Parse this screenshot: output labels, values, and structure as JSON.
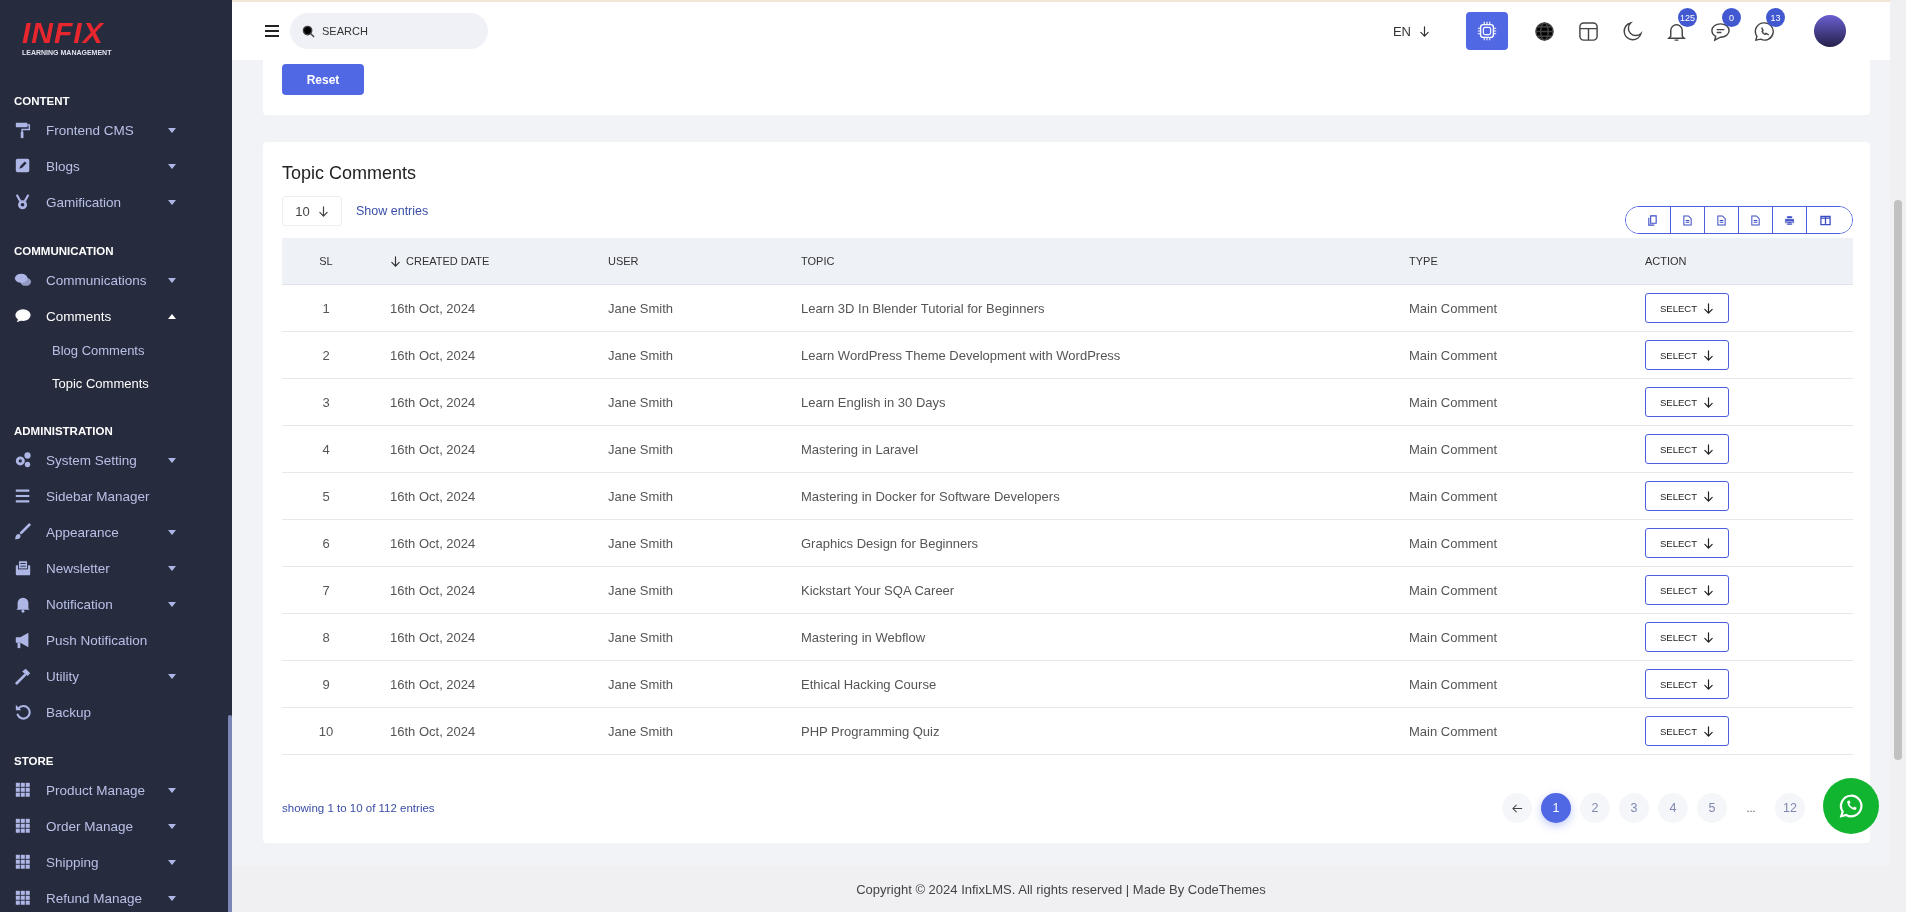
{
  "sidebar": {
    "logo": {
      "brand": "INFIX",
      "tagline": "LEARNING MANAGEMENT"
    },
    "sections": [
      {
        "title": "CONTENT",
        "items": [
          {
            "label": "Frontend CMS",
            "kind": "menu",
            "expanded": false
          },
          {
            "label": "Blogs",
            "kind": "menu",
            "expanded": false
          },
          {
            "label": "Gamification",
            "kind": "menu",
            "expanded": false
          }
        ]
      },
      {
        "title": "COMMUNICATION",
        "items": [
          {
            "label": "Communications",
            "kind": "menu",
            "expanded": false
          },
          {
            "label": "Comments",
            "kind": "menu",
            "expanded": true,
            "children": [
              {
                "label": "Blog Comments",
                "selected": false
              },
              {
                "label": "Topic Comments",
                "selected": true
              }
            ]
          }
        ]
      },
      {
        "title": "ADMINISTRATION",
        "items": [
          {
            "label": "System Setting",
            "kind": "menu",
            "expanded": false
          },
          {
            "label": "Sidebar Manager",
            "kind": "link"
          },
          {
            "label": "Appearance",
            "kind": "menu",
            "expanded": false
          },
          {
            "label": "Newsletter",
            "kind": "menu",
            "expanded": false
          },
          {
            "label": "Notification",
            "kind": "menu",
            "expanded": false
          },
          {
            "label": "Push Notification",
            "kind": "link"
          },
          {
            "label": "Utility",
            "kind": "menu",
            "expanded": false
          },
          {
            "label": "Backup",
            "kind": "link"
          }
        ]
      },
      {
        "title": "STORE",
        "items": [
          {
            "label": "Product Manage",
            "kind": "menu",
            "expanded": false
          },
          {
            "label": "Order Manage",
            "kind": "menu",
            "expanded": false
          },
          {
            "label": "Shipping",
            "kind": "menu",
            "expanded": false
          },
          {
            "label": "Refund Manage",
            "kind": "menu",
            "expanded": false
          }
        ]
      }
    ]
  },
  "header": {
    "search": {
      "placeholder": "SEARCH"
    },
    "language": "EN",
    "badges": {
      "notifications": "125",
      "messages": "0",
      "chats": "13"
    }
  },
  "filter_card": {
    "reset_button": "Reset"
  },
  "table_card": {
    "title": "Topic Comments",
    "page_size": "10",
    "show_entries": "Show entries",
    "columns": [
      "SL",
      "CREATED DATE",
      "USER",
      "TOPIC",
      "TYPE",
      "ACTION"
    ],
    "rows": [
      {
        "sl": "1",
        "created_date": "16th Oct, 2024",
        "user": "Jane Smith",
        "topic": "Learn 3D In Blender Tutorial for Beginners",
        "type": "Main Comment",
        "action": "SELECT"
      },
      {
        "sl": "2",
        "created_date": "16th Oct, 2024",
        "user": "Jane Smith",
        "topic": "Learn WordPress Theme Development with WordPress",
        "type": "Main Comment",
        "action": "SELECT"
      },
      {
        "sl": "3",
        "created_date": "16th Oct, 2024",
        "user": "Jane Smith",
        "topic": "Learn English in 30 Days",
        "type": "Main Comment",
        "action": "SELECT"
      },
      {
        "sl": "4",
        "created_date": "16th Oct, 2024",
        "user": "Jane Smith",
        "topic": "Mastering in Laravel",
        "type": "Main Comment",
        "action": "SELECT"
      },
      {
        "sl": "5",
        "created_date": "16th Oct, 2024",
        "user": "Jane Smith",
        "topic": "Mastering in Docker for Software Developers",
        "type": "Main Comment",
        "action": "SELECT"
      },
      {
        "sl": "6",
        "created_date": "16th Oct, 2024",
        "user": "Jane Smith",
        "topic": "Graphics Design for Beginners",
        "type": "Main Comment",
        "action": "SELECT"
      },
      {
        "sl": "7",
        "created_date": "16th Oct, 2024",
        "user": "Jane Smith",
        "topic": "Kickstart Your SQA Career",
        "type": "Main Comment",
        "action": "SELECT"
      },
      {
        "sl": "8",
        "created_date": "16th Oct, 2024",
        "user": "Jane Smith",
        "topic": "Mastering in Webflow",
        "type": "Main Comment",
        "action": "SELECT"
      },
      {
        "sl": "9",
        "created_date": "16th Oct, 2024",
        "user": "Jane Smith",
        "topic": "Ethical Hacking Course",
        "type": "Main Comment",
        "action": "SELECT"
      },
      {
        "sl": "10",
        "created_date": "16th Oct, 2024",
        "user": "Jane Smith",
        "topic": "PHP Programming Quiz",
        "type": "Main Comment",
        "action": "SELECT"
      }
    ],
    "summary": "showing 1 to 10 of 112 entries",
    "pages": [
      {
        "label": "1",
        "kind": "page",
        "selected": true
      },
      {
        "label": "2",
        "kind": "page",
        "selected": false
      },
      {
        "label": "3",
        "kind": "page",
        "selected": false
      },
      {
        "label": "4",
        "kind": "page",
        "selected": false
      },
      {
        "label": "5",
        "kind": "page",
        "selected": false
      },
      {
        "label": "...",
        "kind": "gap"
      },
      {
        "label": "12",
        "kind": "page",
        "selected": false
      }
    ]
  },
  "footer": {
    "text": "Copyright © 2024 InfixLMS. All rights reserved | Made By CodeThemes"
  }
}
